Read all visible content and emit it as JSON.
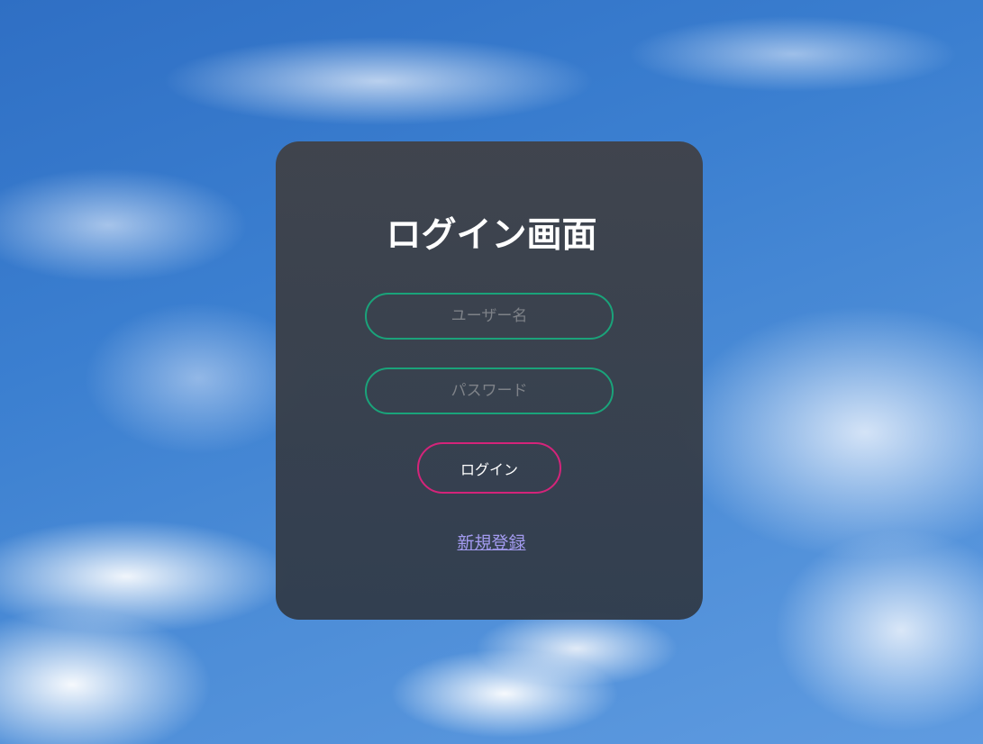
{
  "login": {
    "title": "ログイン画面",
    "username_placeholder": "ユーザー名",
    "password_placeholder": "パスワード",
    "login_button_label": "ログイン",
    "register_link_label": "新規登録"
  },
  "colors": {
    "field_border": "#1aa37a",
    "button_border": "#d4247a",
    "link": "#a39bf0",
    "panel": "#3f4248",
    "sky": "#3b7fd0"
  }
}
